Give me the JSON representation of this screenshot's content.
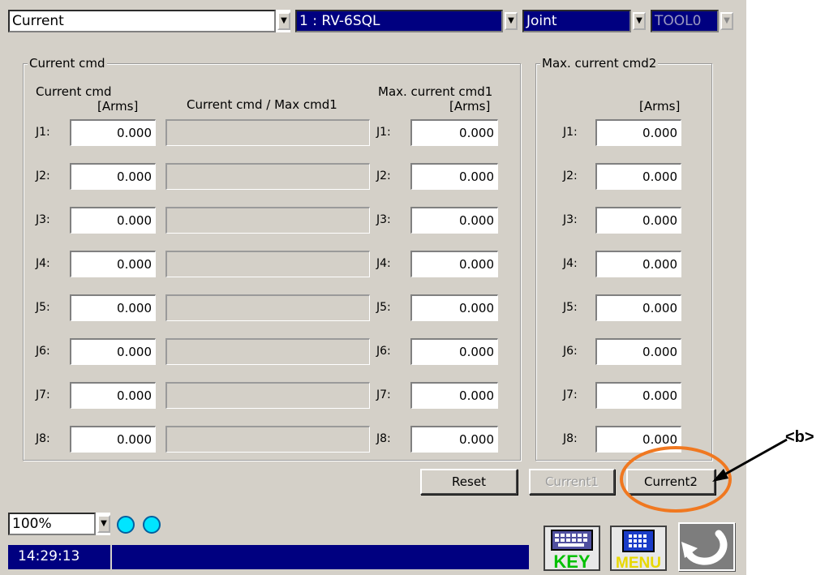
{
  "top_bar": {
    "mode": "Current",
    "robot": "1 : RV-6SQL",
    "coord": "Joint",
    "tool": "TOOL0"
  },
  "group1_title": "Current cmd",
  "group2_title": "Max. current cmd2",
  "columns": {
    "current_cmd": "Current cmd",
    "current_unit": "[Arms]",
    "ratio": "Current cmd / Max cmd1",
    "max1": "Max. current cmd1",
    "max1_unit": "[Arms]",
    "max2_unit": "[Arms]"
  },
  "joints": [
    {
      "label": "J1:",
      "current": "0.000",
      "max1": "0.000",
      "max2": "0.000",
      "ratio": 0
    },
    {
      "label": "J2:",
      "current": "0.000",
      "max1": "0.000",
      "max2": "0.000",
      "ratio": 0
    },
    {
      "label": "J3:",
      "current": "0.000",
      "max1": "0.000",
      "max2": "0.000",
      "ratio": 0
    },
    {
      "label": "J4:",
      "current": "0.000",
      "max1": "0.000",
      "max2": "0.000",
      "ratio": 0
    },
    {
      "label": "J5:",
      "current": "0.000",
      "max1": "0.000",
      "max2": "0.000",
      "ratio": 0
    },
    {
      "label": "J6:",
      "current": "0.000",
      "max1": "0.000",
      "max2": "0.000",
      "ratio": 0
    },
    {
      "label": "J7:",
      "current": "0.000",
      "max1": "0.000",
      "max2": "0.000",
      "ratio": 0
    },
    {
      "label": "J8:",
      "current": "0.000",
      "max1": "0.000",
      "max2": "0.000",
      "ratio": 0
    }
  ],
  "buttons": {
    "reset": "Reset",
    "current1": "Current1",
    "current2": "Current2"
  },
  "status": {
    "zoom": "100%",
    "time": "14:29:13"
  },
  "icons": {
    "key_label": "KEY",
    "menu_label": "MENU",
    "led_color": "#00e5ff"
  },
  "annotation": "<b>",
  "colors": {
    "title_blue": "#000080",
    "highlight": "#f07820",
    "panel": "#d4d0c8"
  }
}
